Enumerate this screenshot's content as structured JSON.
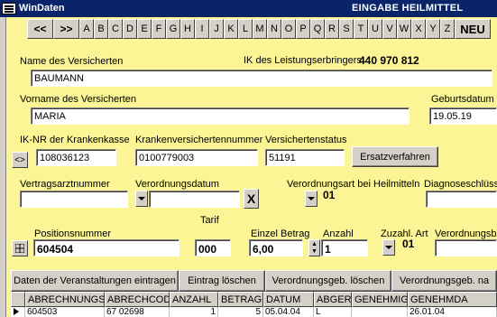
{
  "window": {
    "app_title": "WinDaten",
    "caption": "EINGABE HEILMITTEL"
  },
  "letterbar": {
    "prev": "<<",
    "next": ">>",
    "letters": [
      "A",
      "B",
      "C",
      "D",
      "E",
      "F",
      "G",
      "H",
      "I",
      "J",
      "K",
      "L",
      "M",
      "N",
      "O",
      "P",
      "Q",
      "R",
      "S",
      "T",
      "U",
      "V",
      "W",
      "X",
      "Y",
      "Z"
    ],
    "new": "NEU"
  },
  "form": {
    "name_label": "Name des Versicherten",
    "name_value": "BAUMANN",
    "ik_label": "IK des Leistungserbringers",
    "ik_value": "440 970 812",
    "vorname_label": "Vorname des Versicherten",
    "vorname_value": "MARIA",
    "geburtsdatum_label": "Geburtsdatum",
    "geburtsdatum_value": "19.05.19",
    "iknr_label": "IK-NR der Krankenkasse",
    "iknr_value": "108036123",
    "kvnr_label": "Krankenversichertennummer",
    "kvnr_value": "0100779003",
    "status_label": "Versichertenstatus",
    "status_value": "51191",
    "ersatz_button": "Ersatzverfahren",
    "swap_button": "<>",
    "arzt_label": "Vertragsarztnummer",
    "arzt_value": "",
    "vdatum_label": "Verordnungsdatum",
    "vdatum_value": "",
    "clear_button": "X",
    "vart_label": "Verordnungsart bei Heilmitteln",
    "vart_value": "01",
    "diagnose_label": "Diagnoseschlüss",
    "tarif_label": "Tarif",
    "pos_label": "Positionsnummer",
    "pos_value": "604504",
    "tarif_value": "000",
    "einzel_label": "Einzel Betrag",
    "einzel_value": "6,00",
    "anzahl_label": "Anzahl",
    "anzahl_value": "1",
    "zuzahl_label": "Zuzahl. Art",
    "zuzahl_value": "01",
    "vnr_label": "Verordnungsbl"
  },
  "actions": [
    "Daten der Veranstaltungen eintragen",
    "Eintrag löschen",
    "Verordnungsgeb. löschen",
    "Verordnungsgeb. na"
  ],
  "grid": {
    "columns": [
      "ABRECHNUNGSNR",
      "ABRECHCODE",
      "ANZAHL",
      "BETRAG",
      "DATUM",
      "ABGER",
      "GENEHMIG",
      "GENEHMDA"
    ],
    "rows": [
      [
        "604503",
        "67 02698",
        "1",
        "5",
        "05.04.04",
        "L",
        "",
        "26.01.04"
      ]
    ]
  }
}
